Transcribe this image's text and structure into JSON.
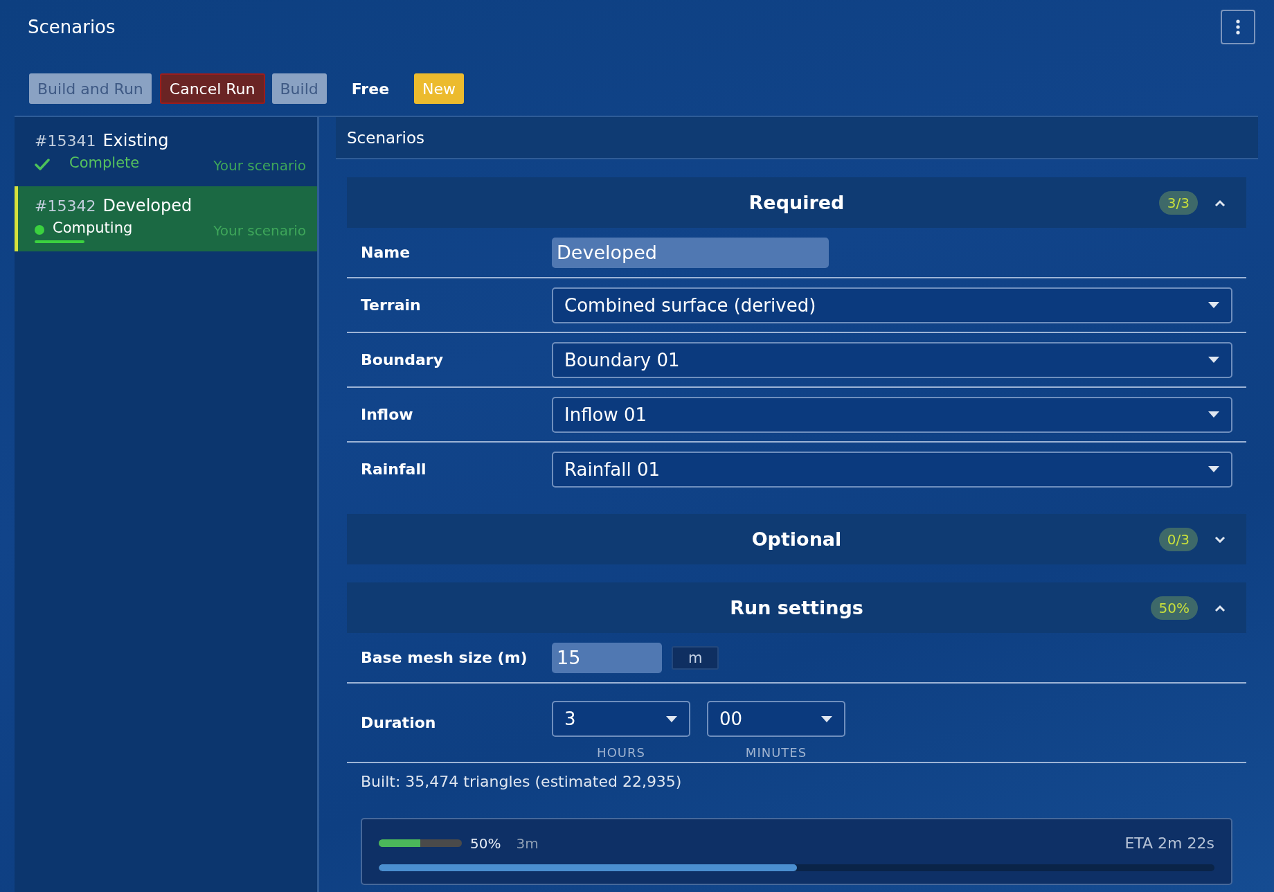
{
  "header": {
    "title": "Scenarios"
  },
  "toolbar": [
    {
      "label": "Build and Run",
      "kind": "muted"
    },
    {
      "label": "Cancel Run",
      "kind": "danger"
    },
    {
      "label": "Build",
      "kind": "muted"
    },
    {
      "label": "Free",
      "kind": "plain"
    },
    {
      "label": "New",
      "kind": "warning"
    }
  ],
  "sidebar": {
    "items": [
      {
        "number": "#15341",
        "name": "Existing",
        "status": "Complete",
        "kind": "done",
        "owner": "Your scenario",
        "selected": false
      },
      {
        "number": "#15342",
        "name": "Developed",
        "status": "Computing",
        "kind": "running",
        "owner": "Your scenario",
        "selected": true
      }
    ]
  },
  "panel": {
    "title": "Scenarios",
    "sections": [
      {
        "title": "Required",
        "badge": "3/3",
        "expanded": true,
        "rows": [
          {
            "label": "Name",
            "kind": "text",
            "value": "Developed"
          },
          {
            "label": "Terrain",
            "kind": "select",
            "value": "Combined surface (derived)"
          },
          {
            "label": "Boundary",
            "kind": "select",
            "value": "Boundary 01"
          },
          {
            "label": "Inflow",
            "kind": "select",
            "value": "Inflow 01"
          },
          {
            "label": "Rainfall",
            "kind": "select",
            "value": "Rainfall 01"
          }
        ]
      },
      {
        "title": "Optional",
        "badge": "0/3",
        "expanded": false
      },
      {
        "title": "Run settings",
        "badge": "50%",
        "expanded": true,
        "rows": [
          {
            "label": "Base mesh size (m)",
            "kind": "number",
            "value": "15",
            "unit": "m"
          },
          {
            "label": "Duration",
            "kind": "duration",
            "fields": [
              {
                "value": "3",
                "caption": "HOURS"
              },
              {
                "value": "00",
                "caption": "MINUTES"
              }
            ]
          }
        ],
        "summary": "Built: 35,474 triangles (estimated 22,935)",
        "progress": {
          "meter": {
            "level": 0.5
          },
          "percent": "50%",
          "elapsed": "3m",
          "eta": "ETA 2m 22s",
          "overall": {
            "level": 0.5
          }
        }
      }
    ]
  }
}
